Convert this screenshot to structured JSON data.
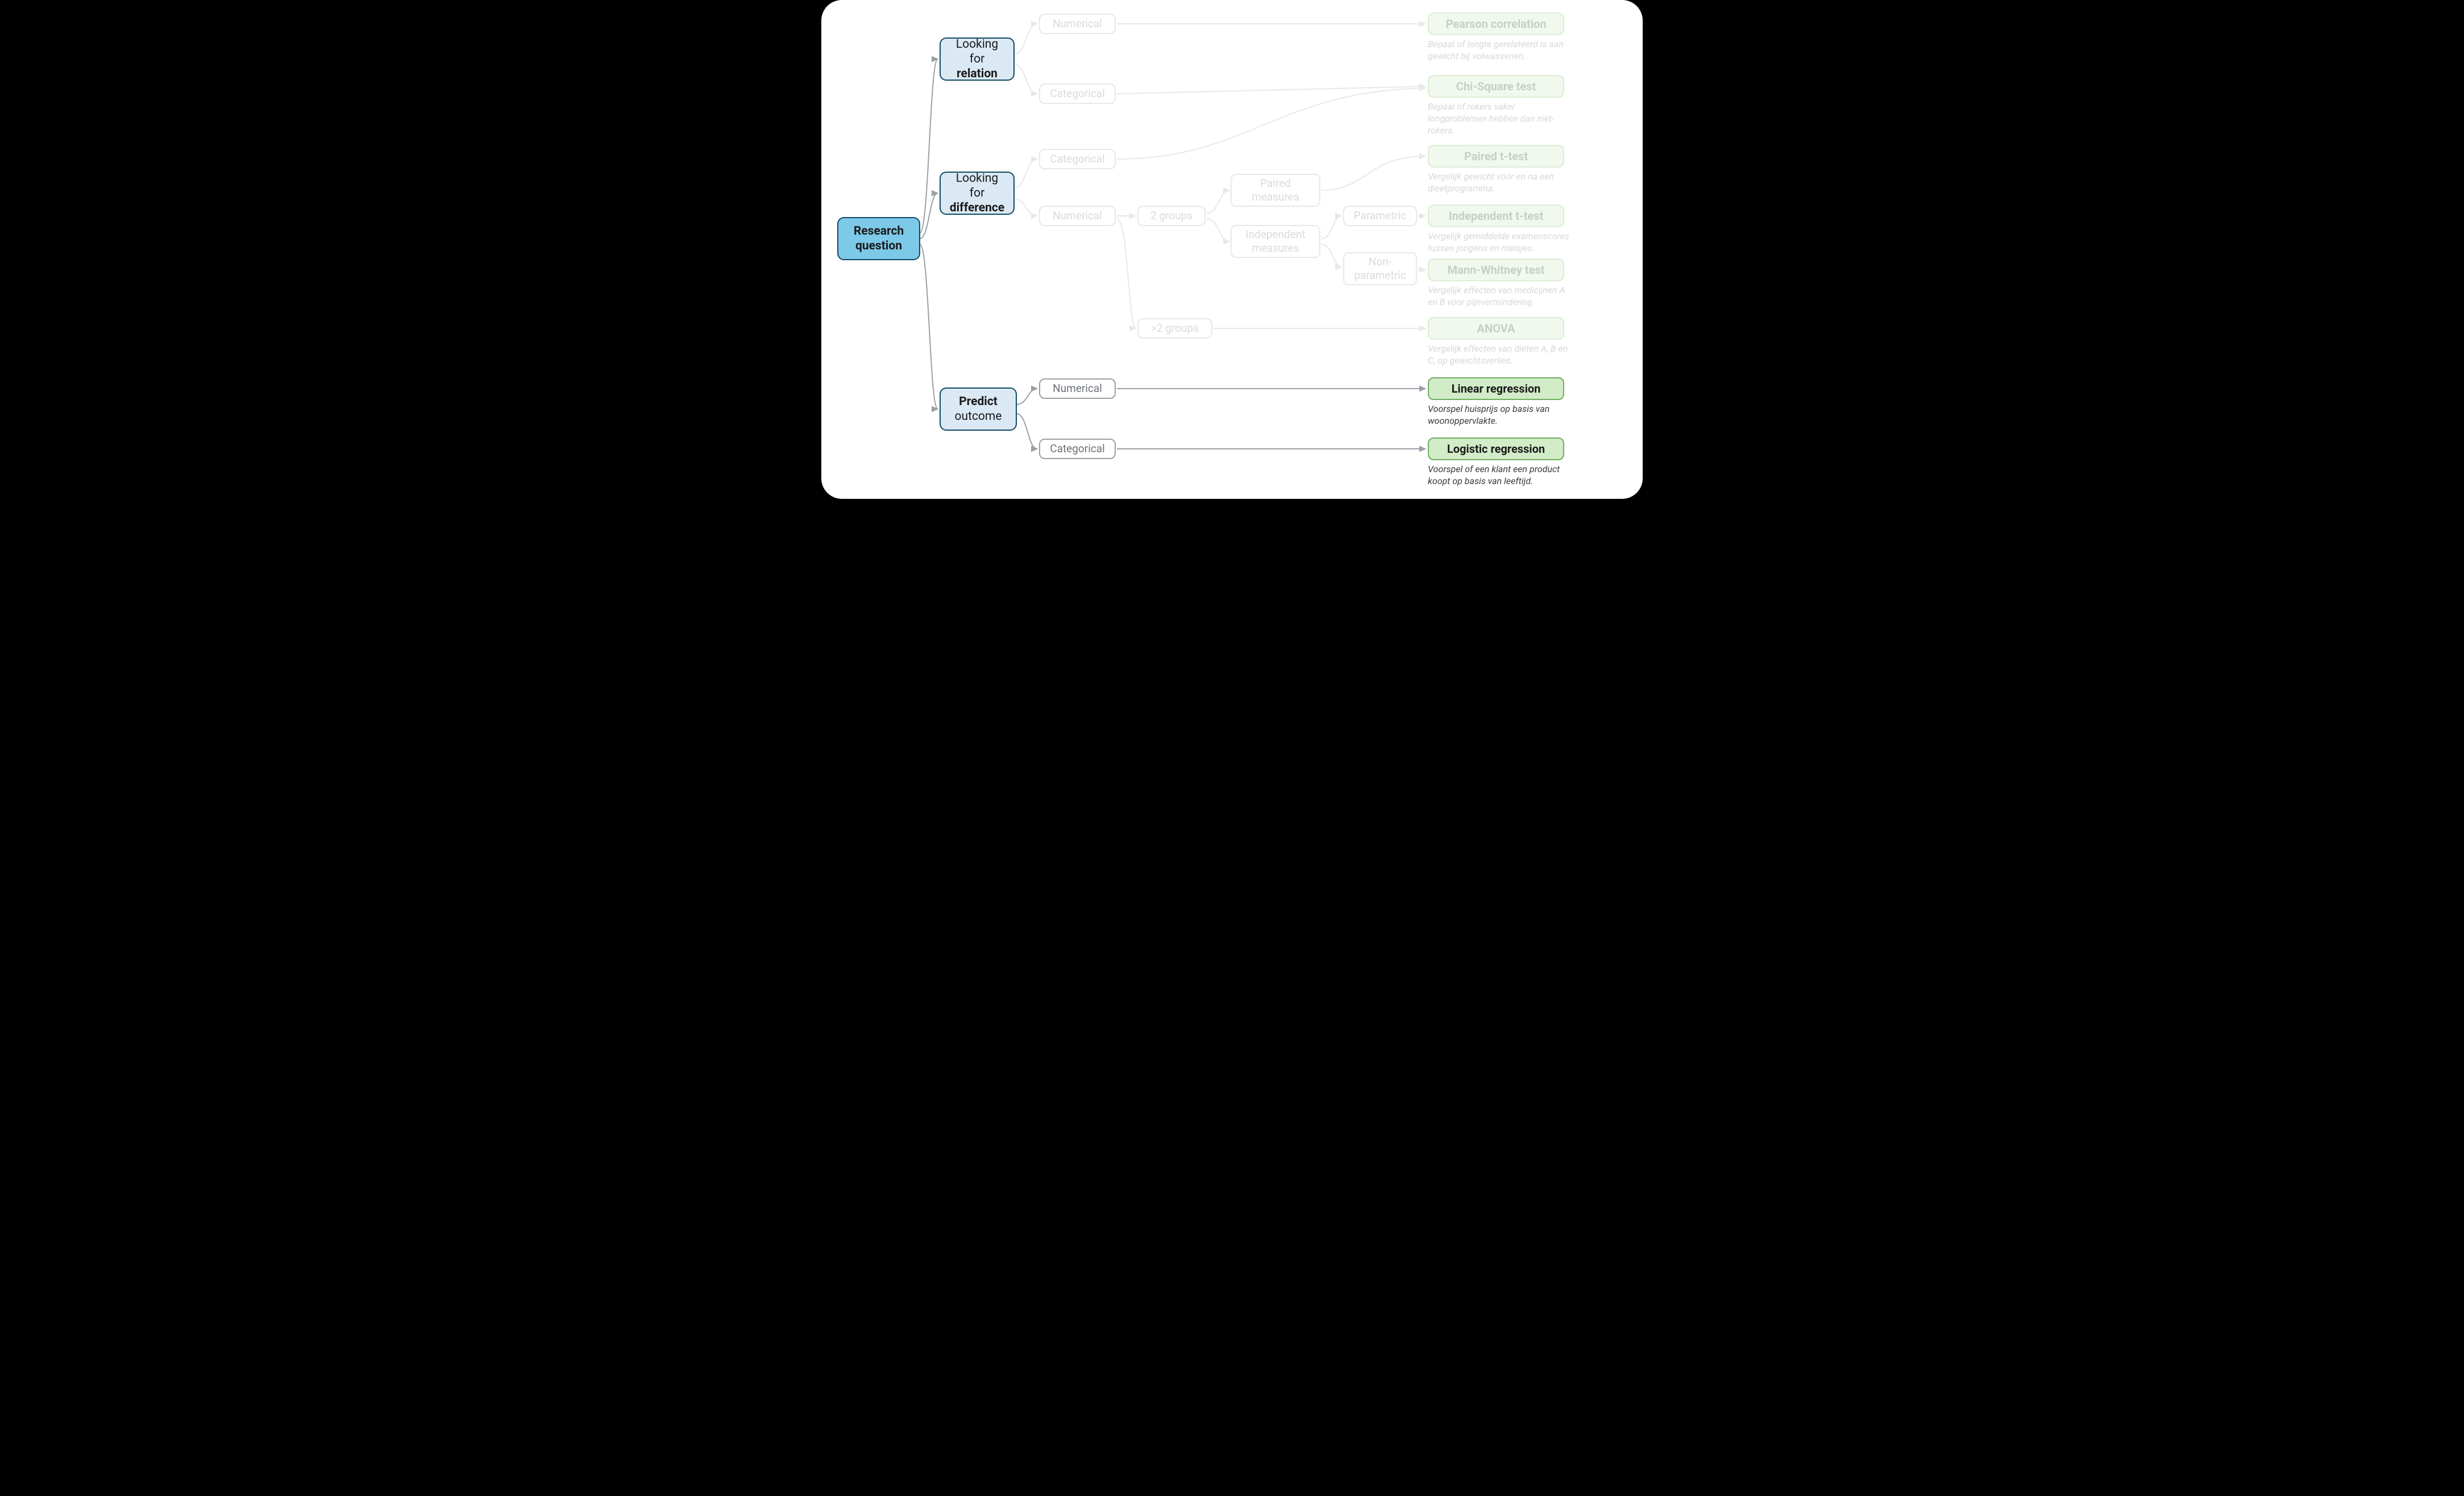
{
  "root": {
    "line1": "Research",
    "line2": "question"
  },
  "branches": {
    "relation": {
      "l1": "Looking for",
      "l2": "relation"
    },
    "difference": {
      "l1": "Looking for",
      "l2": "difference"
    },
    "predict": {
      "l1": "Predict",
      "l2": "outcome"
    }
  },
  "mid": {
    "numerical": "Numerical",
    "categorical": "Categorical",
    "two_groups": "2 groups",
    "more_groups": ">2 groups",
    "paired": {
      "l1": "Paired",
      "l2": "measures"
    },
    "independent": {
      "l1": "Independent",
      "l2": "measures"
    },
    "parametric": "Parametric",
    "nonparam": {
      "l1": "Non-",
      "l2": "parametric"
    }
  },
  "tests": {
    "pearson": {
      "title": "Pearson correlation",
      "desc": "Bepaal of lengte gerelateerd is aan gewicht bij volwassenen."
    },
    "chi": {
      "title": "Chi-Square test",
      "desc": "Bepaal of rokers vaker longproblemen hebben dan niet-rokers."
    },
    "pairedt": {
      "title": "Paired t-test",
      "desc": "Vergelijk gewicht vóór en na een dieetprogramma."
    },
    "indt": {
      "title": "Independent t-test",
      "desc": "Vergelijk gemiddelde examenscores tussen jongens en meisjes."
    },
    "mann": {
      "title": "Mann-Whitney test",
      "desc": "Vergelijk effecten van medicijnen A en B voor pijnvermindering."
    },
    "anova": {
      "title": "ANOVA",
      "desc": "Vergelijk effecten van diëten A, B en C, op gewichtsverlies."
    },
    "linreg": {
      "title": "Linear regression",
      "desc": "Voorspel huisprijs op basis van woonoppervlakte."
    },
    "logreg": {
      "title": "Logistic regression",
      "desc": "Voorspel of een klant een product koopt op basis van leeftijd."
    }
  }
}
